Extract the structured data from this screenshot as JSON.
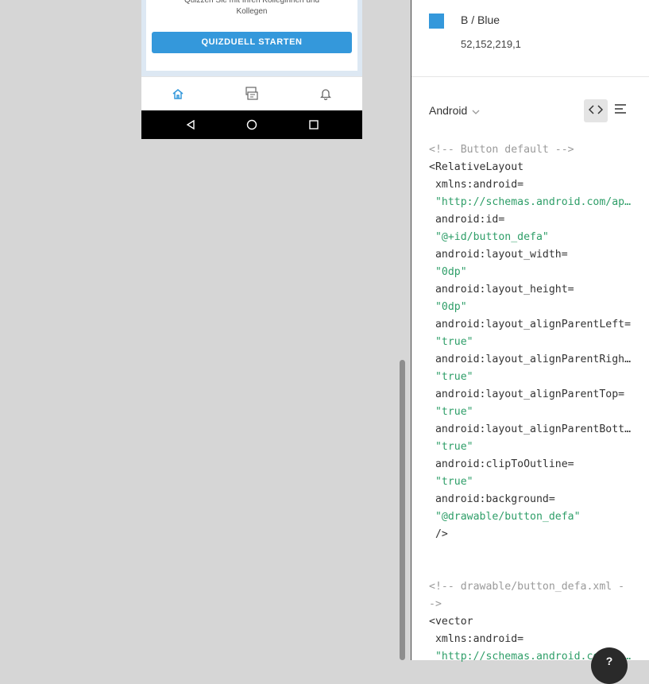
{
  "phone": {
    "card_text_line1": "Quizzen Sie mit Ihren Kolleginnen und",
    "card_text_line2": "Kollegen",
    "start_button": "QUIZDUELL STARTEN",
    "tabs": [
      "home-icon",
      "quiz-cards-icon",
      "bell-icon"
    ],
    "nav": [
      "back-icon",
      "home-circle-icon",
      "recents-icon"
    ]
  },
  "inspector": {
    "color": {
      "name": "B / Blue",
      "rgba": "52,152,219,1",
      "hex": "#3498db"
    },
    "platform": "Android",
    "code_lines": [
      {
        "t": "<!-- Button default -->",
        "k": "com"
      },
      {
        "t": "<RelativeLayout",
        "k": "tag"
      },
      {
        "t": " xmlns:android=",
        "k": "attr"
      },
      {
        "t": " \"http://schemas.android.com/apk/res/android\"",
        "k": "str"
      },
      {
        "t": " android:id=",
        "k": "attr"
      },
      {
        "t": " \"@+id/button_defa\"",
        "k": "str"
      },
      {
        "t": " android:layout_width=",
        "k": "attr"
      },
      {
        "t": " \"0dp\"",
        "k": "str"
      },
      {
        "t": " android:layout_height=",
        "k": "attr"
      },
      {
        "t": " \"0dp\"",
        "k": "str"
      },
      {
        "t": " android:layout_alignParentLeft=",
        "k": "attr"
      },
      {
        "t": " \"true\"",
        "k": "str"
      },
      {
        "t": " android:layout_alignParentRight=",
        "k": "attr"
      },
      {
        "t": " \"true\"",
        "k": "str"
      },
      {
        "t": " android:layout_alignParentTop=",
        "k": "attr"
      },
      {
        "t": " \"true\"",
        "k": "str"
      },
      {
        "t": " android:layout_alignParentBottom=",
        "k": "attr"
      },
      {
        "t": " \"true\"",
        "k": "str"
      },
      {
        "t": " android:clipToOutline=",
        "k": "attr"
      },
      {
        "t": " \"true\"",
        "k": "str"
      },
      {
        "t": " android:background=",
        "k": "attr"
      },
      {
        "t": " \"@drawable/button_defa\"",
        "k": "str"
      },
      {
        "t": " />",
        "k": "tag"
      },
      {
        "t": "",
        "k": "tag"
      },
      {
        "t": "",
        "k": "tag"
      },
      {
        "t": "<!-- drawable/button_defa.xml -",
        "k": "com"
      },
      {
        "t": "->",
        "k": "com"
      },
      {
        "t": "<vector",
        "k": "tag"
      },
      {
        "t": " xmlns:android=",
        "k": "attr"
      },
      {
        "t": " \"http://schemas.android.com/apk/res/android\"",
        "k": "str"
      }
    ]
  }
}
